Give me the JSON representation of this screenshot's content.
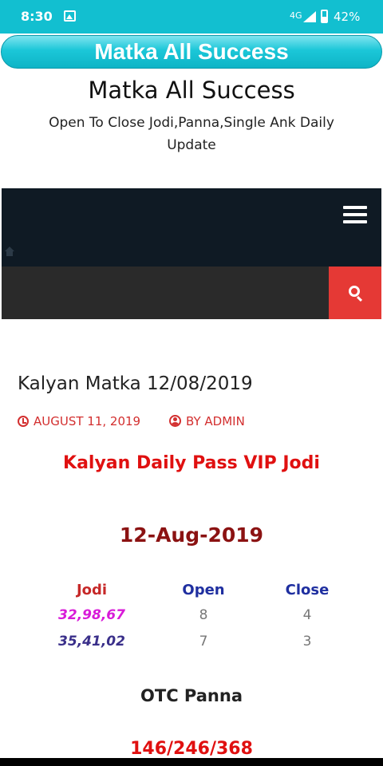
{
  "status_bar": {
    "time": "8:30",
    "network": "4G",
    "battery": "42%",
    "battery_level": 0.42
  },
  "app_bar": {
    "title": "Matka All Success"
  },
  "site": {
    "title": "Matka All Success",
    "tagline": "Open To Close Jodi,Panna,Single Ank Daily Update"
  },
  "search": {
    "placeholder": ""
  },
  "post": {
    "title": "Kalyan Matka 12/08/2019",
    "date": "AUGUST 11, 2019",
    "author": "BY ADMIN",
    "vip_heading": "Kalyan Daily Pass VIP Jodi",
    "date_heading": "12-Aug-2019",
    "table": {
      "headers": [
        "Jodi",
        "Open",
        "Close"
      ],
      "rows": [
        [
          "32,98,67",
          "8",
          "4"
        ],
        [
          "35,41,02",
          "7",
          "3"
        ]
      ]
    },
    "otc_heading": "OTC Panna",
    "panna_value": "146/246/368"
  },
  "colors": {
    "status_bar": "#12bfd0",
    "accent_red": "#e01010",
    "navbar": "#0f1a24",
    "search_button": "#e53935"
  }
}
